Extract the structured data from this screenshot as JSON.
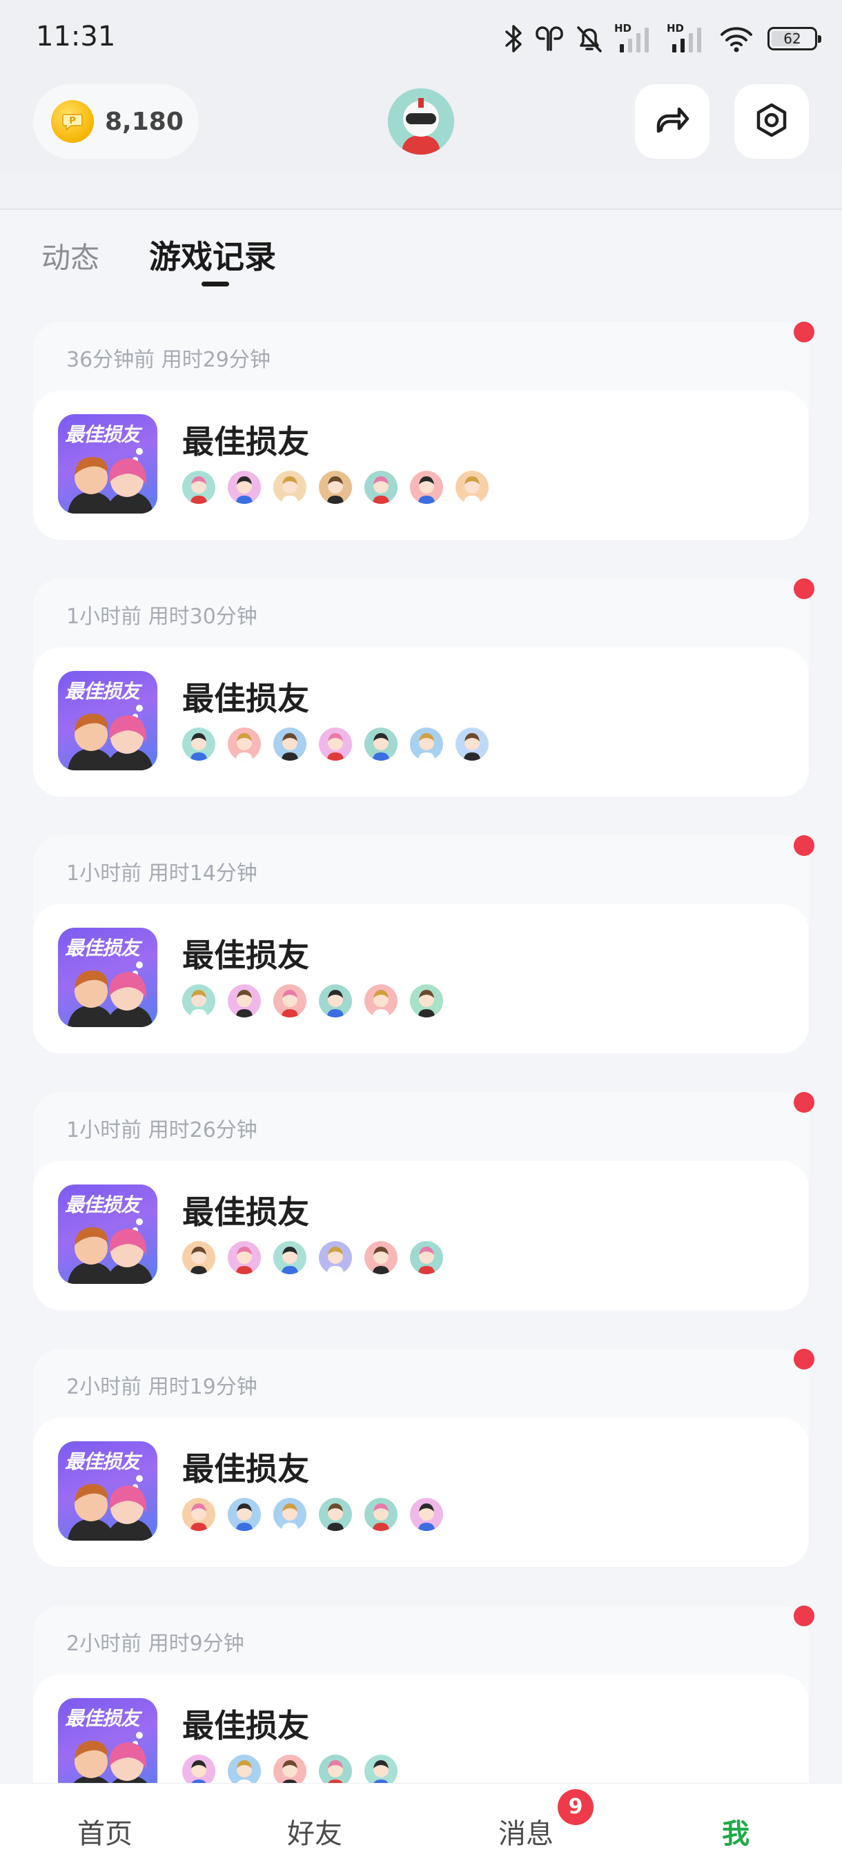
{
  "status_bar": {
    "time": "11:31",
    "network_label": "HD",
    "battery": "62"
  },
  "header": {
    "coins": "8,180",
    "icons": [
      "coin-icon",
      "profile-avatar",
      "share-icon",
      "settings-icon"
    ]
  },
  "tabs": {
    "dynamic": "动态",
    "records": "游戏记录"
  },
  "game": {
    "name": "最佳损友",
    "icon_title": "最佳损友"
  },
  "records": [
    {
      "meta": "36分钟前 用时29分钟",
      "game_name": "最佳损友",
      "players": [
        "#a8e0d6",
        "#f0b8e8",
        "#f4d8b0",
        "#e8c090",
        "#9fd9cf",
        "#f8b8b8",
        "#f8d0a8"
      ]
    },
    {
      "meta": "1小时前 用时30分钟",
      "game_name": "最佳损友",
      "players": [
        "#a8e0d6",
        "#f8b8b8",
        "#a8d0f0",
        "#f0b8e8",
        "#9fd9cf",
        "#a8d0f0",
        "#c0d8f8"
      ]
    },
    {
      "meta": "1小时前 用时14分钟",
      "game_name": "最佳损友",
      "players": [
        "#a8e0d6",
        "#f0b8e8",
        "#f8b8b8",
        "#9fd9cf",
        "#f8b8b8",
        "#a8e0c8"
      ]
    },
    {
      "meta": "1小时前 用时26分钟",
      "game_name": "最佳损友",
      "players": [
        "#f8d0a8",
        "#f0b8e8",
        "#a8e0d6",
        "#b8b8f0",
        "#f8b8b8",
        "#9fd9cf"
      ]
    },
    {
      "meta": "2小时前 用时19分钟",
      "game_name": "最佳损友",
      "players": [
        "#f8d0a8",
        "#a8d0f0",
        "#a8d0f0",
        "#9fd9cf",
        "#9fd9cf",
        "#f0b8e8"
      ]
    },
    {
      "meta": "2小时前 用时9分钟",
      "game_name": "最佳损友",
      "players": [
        "#f0b8e8",
        "#a8d0f0",
        "#f8b8b8",
        "#9fd9cf",
        "#a8e0d6"
      ]
    }
  ],
  "bottom_nav": {
    "home": "首页",
    "friends": "好友",
    "messages": "消息",
    "messages_badge": "9",
    "me": "我"
  },
  "colors": {
    "accent_green": "#1faa4a",
    "badge_red": "#ee3a4a",
    "coin_gold": "#f7b500"
  }
}
